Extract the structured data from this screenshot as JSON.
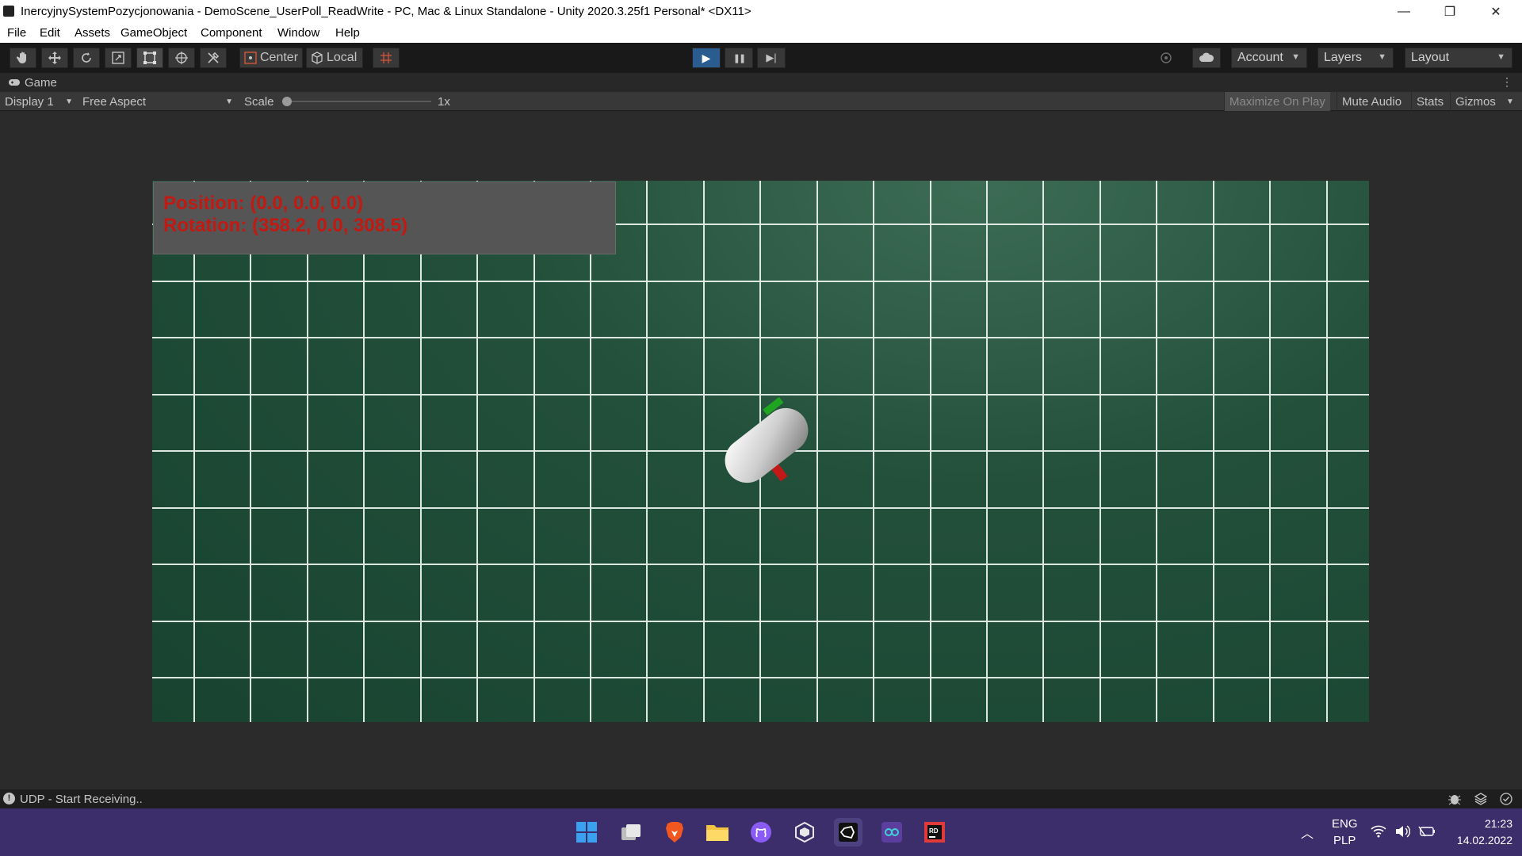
{
  "window": {
    "title": "InercyjnySystemPozycjonowania - DemoScene_UserPoll_ReadWrite - PC, Mac & Linux Standalone - Unity 2020.3.25f1 Personal* <DX11>",
    "minimize": "—",
    "restore": "❐",
    "close": "✕"
  },
  "menu": [
    "File",
    "Edit",
    "Assets",
    "GameObject",
    "Component",
    "Window",
    "Help"
  ],
  "toolbar": {
    "center_label": "Center",
    "local_label": "Local",
    "account_label": "Account",
    "layers_label": "Layers",
    "layout_label": "Layout",
    "play_icon": "▶",
    "pause_icon": "❚❚",
    "step_icon": "▶|"
  },
  "game_tab": {
    "label": "Game"
  },
  "game_bar": {
    "display": "Display 1",
    "aspect": "Free Aspect",
    "scale_label": "Scale",
    "scale_value": "1x",
    "maximize": "Maximize On Play",
    "mute": "Mute Audio",
    "stats": "Stats",
    "gizmos": "Gizmos"
  },
  "hud": {
    "position": "Position: (0.0, 0.0, 0.0)",
    "rotation": "Rotation: (358.2, 0.0, 308.5)"
  },
  "status": {
    "message": "UDP - Start Receiving.."
  },
  "taskbar": {
    "lang_top": "ENG",
    "lang_bottom": "PLP",
    "time": "21:23",
    "date": "14.02.2022"
  },
  "colors": {
    "hud_text": "#c11a12",
    "grid_line": "#e8f0ec",
    "ground": "#1e4a36",
    "play_accent": "#2a5c8f",
    "taskbar": "#3b2e6b"
  }
}
